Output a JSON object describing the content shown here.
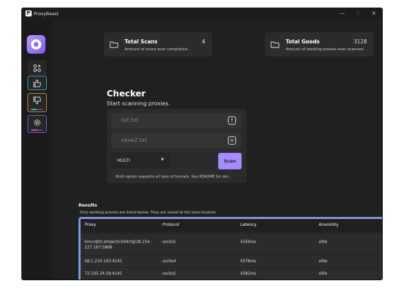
{
  "window": {
    "title": "ProxyBeast",
    "app_icon_letter": "P"
  },
  "titlebar": {
    "minimize": "—",
    "maximize": "☐",
    "close": "✕"
  },
  "stats": [
    {
      "title": "Total Scans",
      "value": "4",
      "desc": "Amount of scans ever completed."
    },
    {
      "title": "Total Goods",
      "value": "3128",
      "desc": "Amount of working proxies ever scanned."
    }
  ],
  "checker": {
    "title": "Checker",
    "subtitle": "Start scanning proxies.",
    "input_file": "list.txt",
    "output_file": "save2.txt",
    "mode": "MULTI",
    "scan_label": "Scan",
    "hint": "Multi option supports all type of formats. See README for doc."
  },
  "results": {
    "title": "Results",
    "subtitle": "Only working proxies are listed below. They are saved at the save location.",
    "columns": [
      "Proxy",
      "Protocol",
      "Latency",
      "Anonimty"
    ],
    "rows": [
      {
        "proxy_line1": "kmcrqfxt:emjwc0c049ct@38.154.",
        "proxy_line2": "227.167:5868",
        "protocol": "socks5",
        "latency": "4359ms",
        "anonymity": "elite"
      },
      {
        "proxy_line1": "68.1.210.163:4145",
        "proxy_line2": "",
        "protocol": "socks4",
        "latency": "4378ms",
        "anonymity": "elite"
      },
      {
        "proxy_line1": "72.195.34.58:4145",
        "proxy_line2": "",
        "protocol": "socks5",
        "latency": "4382ms",
        "anonymity": "elite"
      }
    ]
  },
  "sidebar": {
    "items": [
      {
        "icon": "apps-add-icon"
      },
      {
        "icon": "thumbs-up-icon"
      },
      {
        "icon": "thumbs-down-icon",
        "progress": 0.45,
        "progress_color": "#3fb3c6"
      },
      {
        "icon": "gear-icon",
        "progress": 0.5,
        "progress_color": "#c44fd8"
      }
    ]
  },
  "colors": {
    "accent": "#a58bff",
    "teal": "#3fb3c6",
    "orange": "#c98a35"
  }
}
